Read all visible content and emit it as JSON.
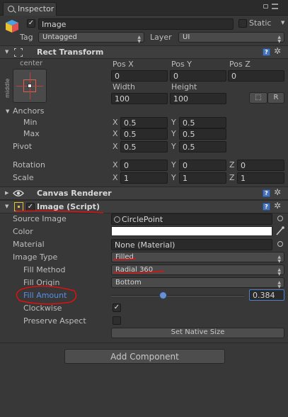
{
  "tab": {
    "title": "Inspector"
  },
  "object": {
    "name": "Image",
    "static_label": "Static",
    "tag_label": "Tag",
    "tag_value": "Untagged",
    "layer_label": "Layer",
    "layer_value": "UI"
  },
  "rect_transform": {
    "title": "Rect Transform",
    "anchor_preset_top": "center",
    "anchor_preset_side": "middle",
    "pos_x_label": "Pos X",
    "pos_y_label": "Pos Y",
    "pos_z_label": "Pos Z",
    "pos_x": "0",
    "pos_y": "0",
    "pos_z": "0",
    "width_label": "Width",
    "height_label": "Height",
    "width": "100",
    "height": "100",
    "blueprint_btn": "⬚",
    "raw_btn": "R",
    "anchors_label": "Anchors",
    "min_label": "Min",
    "max_label": "Max",
    "min_x": "0.5",
    "min_y": "0.5",
    "max_x": "0.5",
    "max_y": "0.5",
    "pivot_label": "Pivot",
    "pivot_x": "0.5",
    "pivot_y": "0.5",
    "rotation_label": "Rotation",
    "rot_x": "0",
    "rot_y": "0",
    "rot_z": "0",
    "scale_label": "Scale",
    "scale_x": "1",
    "scale_y": "1",
    "scale_z": "1",
    "x": "X",
    "y": "Y",
    "z": "Z"
  },
  "canvas_renderer": {
    "title": "Canvas Renderer"
  },
  "image": {
    "title": "Image (Script)",
    "source_image_label": "Source Image",
    "source_image_value": "CirclePoint",
    "color_label": "Color",
    "material_label": "Material",
    "material_value": "None (Material)",
    "image_type_label": "Image Type",
    "image_type_value": "Filled",
    "fill_method_label": "Fill Method",
    "fill_method_value": "Radial 360",
    "fill_origin_label": "Fill Origin",
    "fill_origin_value": "Bottom",
    "fill_amount_label": "Fill Amount",
    "fill_amount_value": "0.384",
    "fill_amount_level": 0.384,
    "clockwise_label": "Clockwise",
    "preserve_aspect_label": "Preserve Aspect",
    "set_native_size": "Set Native Size"
  },
  "add_component": "Add Component",
  "colors": {
    "annotation": "#e01010",
    "highlight_text": "#5a8fe8",
    "panel": "#383838"
  },
  "icons": [
    "inspector-icon",
    "lock-icon",
    "menu-icon",
    "cube-icon",
    "rect-transform-icon",
    "eye-icon",
    "image-component-icon",
    "help-icon",
    "gear-icon",
    "object-picker-icon",
    "eyedropper-icon",
    "checkmark-icon"
  ]
}
